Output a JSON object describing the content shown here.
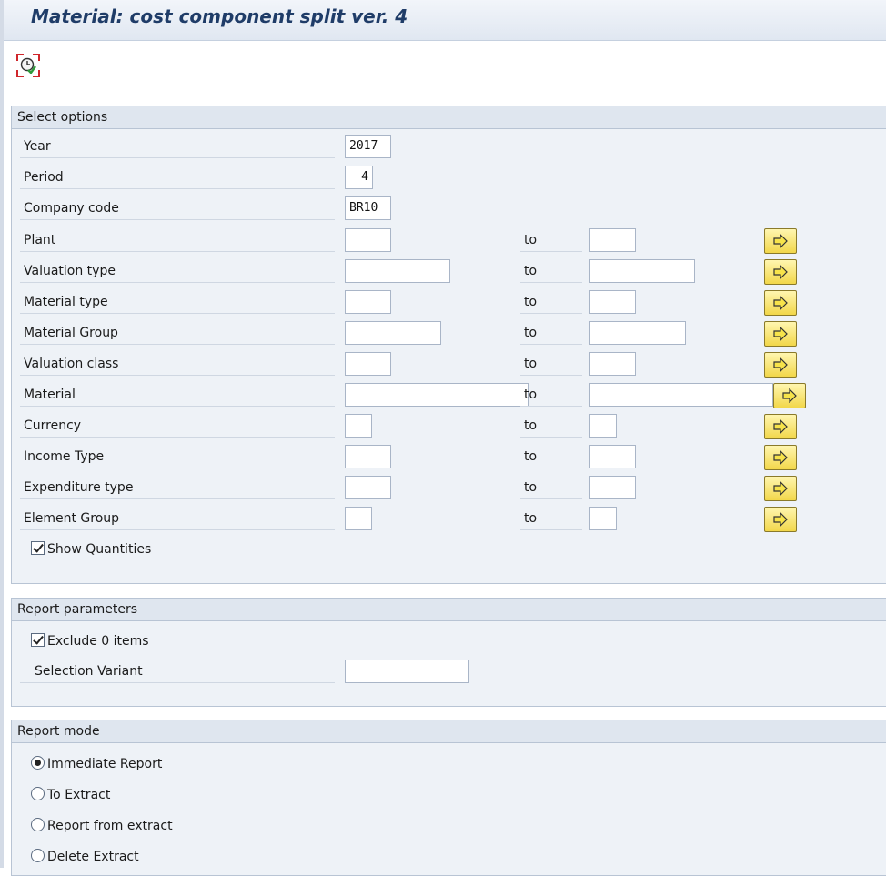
{
  "window": {
    "title": "Material: cost component split ver. 4"
  },
  "toolbar": {
    "execute_icon": "execute-clock-icon"
  },
  "select_options": {
    "header": "Select options",
    "to_label": "to",
    "multi_select_icon": "multiple-selection-arrow-icon",
    "fields": [
      {
        "label": "Year",
        "value": "2017"
      },
      {
        "label": "Period",
        "value": "4"
      },
      {
        "label": "Company code",
        "value": "BR10"
      },
      {
        "label": "Plant",
        "low": "",
        "high": ""
      },
      {
        "label": "Valuation type",
        "low": "",
        "high": ""
      },
      {
        "label": "Material type",
        "low": "",
        "high": ""
      },
      {
        "label": "Material Group",
        "low": "",
        "high": ""
      },
      {
        "label": "Valuation class",
        "low": "",
        "high": ""
      },
      {
        "label": "Material",
        "low": "",
        "high": ""
      },
      {
        "label": "Currency",
        "low": "",
        "high": ""
      },
      {
        "label": "Income Type",
        "low": "",
        "high": ""
      },
      {
        "label": "Expenditure type",
        "low": "",
        "high": ""
      },
      {
        "label": "Element Group",
        "low": "",
        "high": ""
      }
    ],
    "show_quantities": {
      "label": "Show Quantities",
      "checked": true
    }
  },
  "report_parameters": {
    "header": "Report parameters",
    "exclude_zero": {
      "label": "Exclude 0 items",
      "checked": true
    },
    "selection_variant": {
      "label": "Selection Variant",
      "value": ""
    }
  },
  "report_mode": {
    "header": "Report mode",
    "options": [
      {
        "label": "Immediate Report",
        "selected": true
      },
      {
        "label": "To Extract",
        "selected": false
      },
      {
        "label": "Report from extract",
        "selected": false
      },
      {
        "label": "Delete Extract",
        "selected": false
      }
    ]
  }
}
